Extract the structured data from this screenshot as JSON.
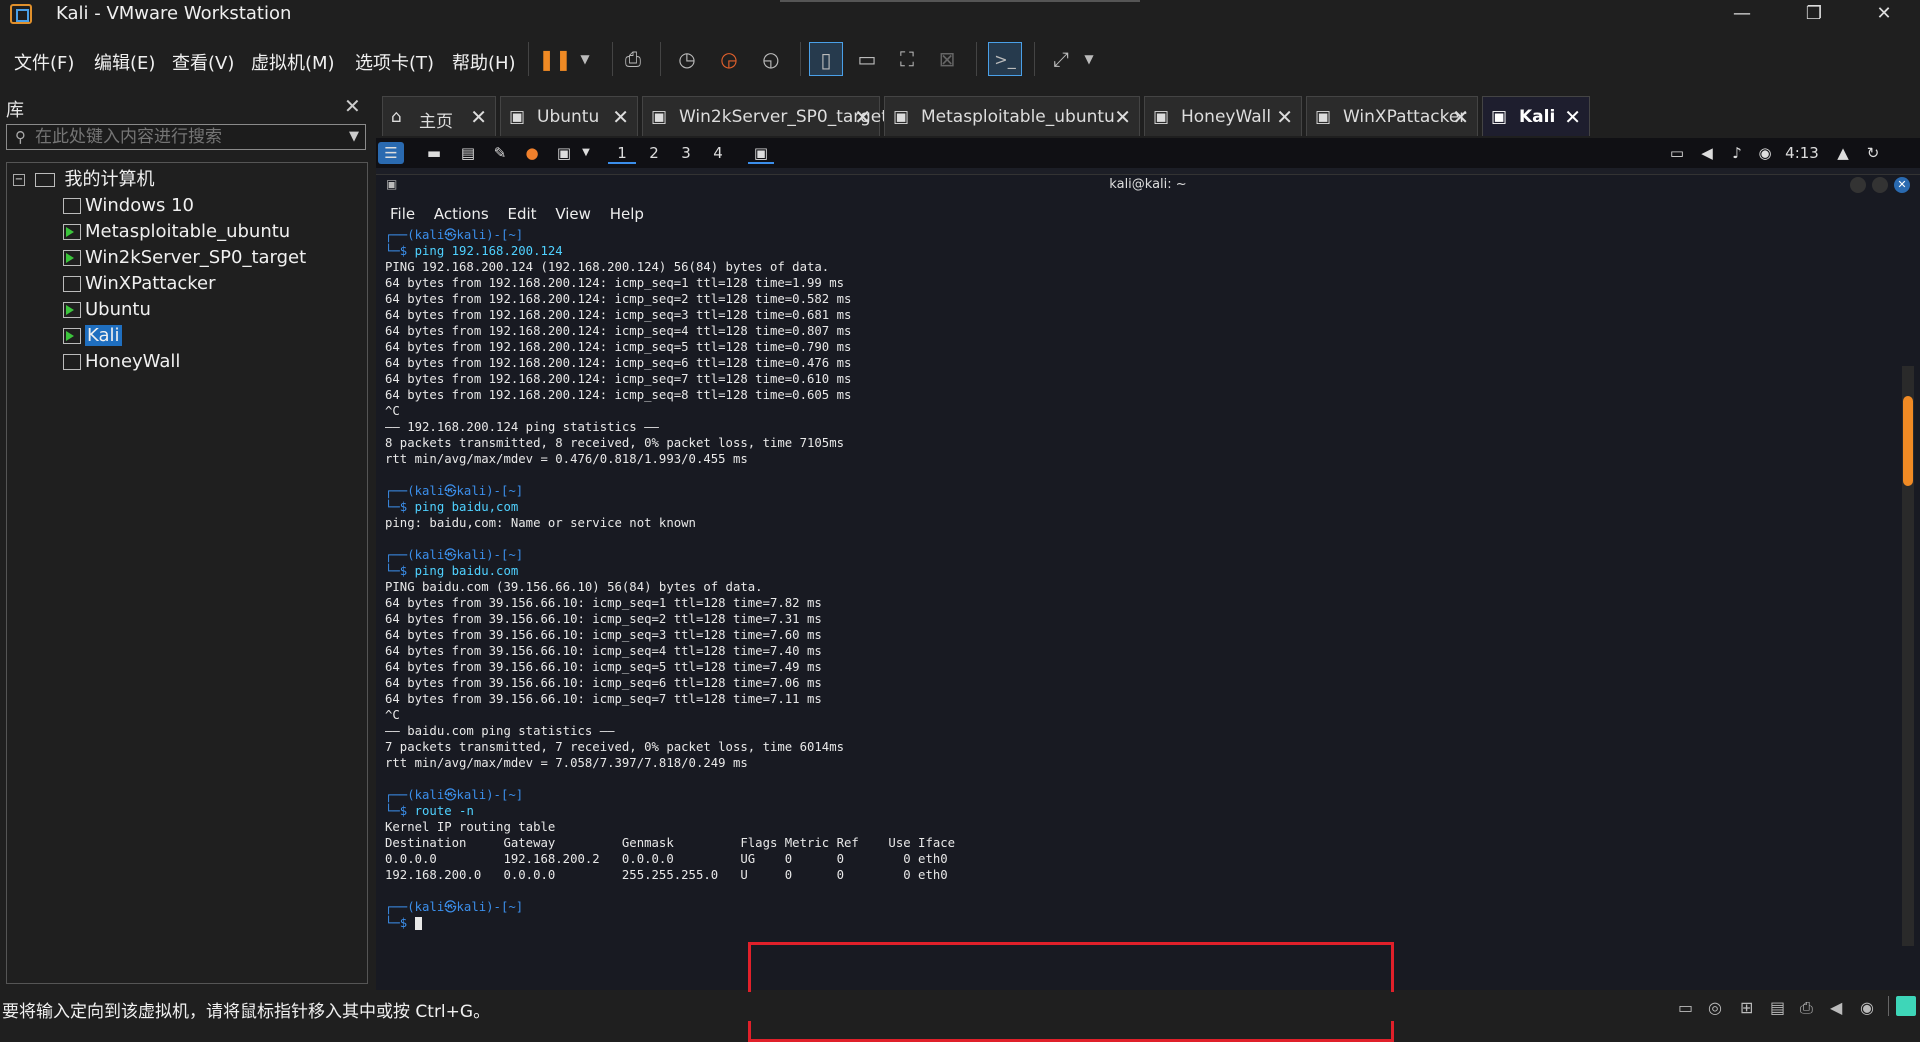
{
  "window": {
    "title": "Kali - VMware Workstation",
    "min": "—",
    "max": "❐",
    "close": "✕"
  },
  "menu": [
    "文件(F)",
    "编辑(E)",
    "查看(V)",
    "虚拟机(M)",
    "选项卡(T)",
    "帮助(H)"
  ],
  "library": {
    "title": "库",
    "close": "✕",
    "search_placeholder": "在此处键入内容进行搜索",
    "root": "我的计算机",
    "items": [
      "Windows 10",
      "Metasploitable_ubuntu",
      "Win2kServer_SP0_target",
      "WinXPattacker",
      "Ubuntu",
      "Kali",
      "HoneyWall"
    ],
    "selected": "Kali"
  },
  "tabs": [
    {
      "label": "主页",
      "icon": "⌂"
    },
    {
      "label": "Ubuntu"
    },
    {
      "label": "Win2kServer_SP0_target"
    },
    {
      "label": "Metasploitable_ubuntu"
    },
    {
      "label": "HoneyWall"
    },
    {
      "label": "WinXPattacker"
    },
    {
      "label": "Kali",
      "active": true
    }
  ],
  "kali_panel": {
    "workspaces": [
      "1",
      "2",
      "3",
      "4"
    ],
    "time": "4:13"
  },
  "terminal": {
    "title": "kali@kali: ~",
    "menu": [
      "File",
      "Actions",
      "Edit",
      "View",
      "Help"
    ],
    "lines": [
      {
        "t": "p"
      },
      {
        "t": "c",
        "v": "ping 192.168.200.124"
      },
      {
        "t": "o",
        "v": "PING 192.168.200.124 (192.168.200.124) 56(84) bytes of data."
      },
      {
        "t": "o",
        "v": "64 bytes from 192.168.200.124: icmp_seq=1 ttl=128 time=1.99 ms"
      },
      {
        "t": "o",
        "v": "64 bytes from 192.168.200.124: icmp_seq=2 ttl=128 time=0.582 ms"
      },
      {
        "t": "o",
        "v": "64 bytes from 192.168.200.124: icmp_seq=3 ttl=128 time=0.681 ms"
      },
      {
        "t": "o",
        "v": "64 bytes from 192.168.200.124: icmp_seq=4 ttl=128 time=0.807 ms"
      },
      {
        "t": "o",
        "v": "64 bytes from 192.168.200.124: icmp_seq=5 ttl=128 time=0.790 ms"
      },
      {
        "t": "o",
        "v": "64 bytes from 192.168.200.124: icmp_seq=6 ttl=128 time=0.476 ms"
      },
      {
        "t": "o",
        "v": "64 bytes from 192.168.200.124: icmp_seq=7 ttl=128 time=0.610 ms"
      },
      {
        "t": "o",
        "v": "64 bytes from 192.168.200.124: icmp_seq=8 ttl=128 time=0.605 ms"
      },
      {
        "t": "o",
        "v": "^C"
      },
      {
        "t": "o",
        "v": "—— 192.168.200.124 ping statistics ——"
      },
      {
        "t": "o",
        "v": "8 packets transmitted, 8 received, 0% packet loss, time 7105ms"
      },
      {
        "t": "o",
        "v": "rtt min/avg/max/mdev = 0.476/0.818/1.993/0.455 ms"
      },
      {
        "t": "o",
        "v": ""
      },
      {
        "t": "p"
      },
      {
        "t": "c",
        "v": "ping baidu,com"
      },
      {
        "t": "o",
        "v": "ping: baidu,com: Name or service not known"
      },
      {
        "t": "o",
        "v": ""
      },
      {
        "t": "p"
      },
      {
        "t": "c",
        "v": "ping baidu.com"
      },
      {
        "t": "o",
        "v": "PING baidu.com (39.156.66.10) 56(84) bytes of data."
      },
      {
        "t": "o",
        "v": "64 bytes from 39.156.66.10: icmp_seq=1 ttl=128 time=7.82 ms"
      },
      {
        "t": "o",
        "v": "64 bytes from 39.156.66.10: icmp_seq=2 ttl=128 time=7.31 ms"
      },
      {
        "t": "o",
        "v": "64 bytes from 39.156.66.10: icmp_seq=3 ttl=128 time=7.60 ms"
      },
      {
        "t": "o",
        "v": "64 bytes from 39.156.66.10: icmp_seq=4 ttl=128 time=7.40 ms"
      },
      {
        "t": "o",
        "v": "64 bytes from 39.156.66.10: icmp_seq=5 ttl=128 time=7.49 ms"
      },
      {
        "t": "o",
        "v": "64 bytes from 39.156.66.10: icmp_seq=6 ttl=128 time=7.06 ms"
      },
      {
        "t": "o",
        "v": "64 bytes from 39.156.66.10: icmp_seq=7 ttl=128 time=7.11 ms"
      },
      {
        "t": "o",
        "v": "^C"
      },
      {
        "t": "o",
        "v": "—— baidu.com ping statistics ——"
      },
      {
        "t": "o",
        "v": "7 packets transmitted, 7 received, 0% packet loss, time 6014ms"
      },
      {
        "t": "o",
        "v": "rtt min/avg/max/mdev = 7.058/7.397/7.818/0.249 ms"
      },
      {
        "t": "o",
        "v": ""
      },
      {
        "t": "p"
      },
      {
        "t": "c",
        "v": "route -n"
      },
      {
        "t": "o",
        "v": "Kernel IP routing table"
      },
      {
        "t": "o",
        "v": "Destination     Gateway         Genmask         Flags Metric Ref    Use Iface"
      },
      {
        "t": "o",
        "v": "0.0.0.0         192.168.200.2   0.0.0.0         UG    0      0        0 eth0"
      },
      {
        "t": "o",
        "v": "192.168.200.0   0.0.0.0         255.255.255.0   U     0      0        0 eth0"
      },
      {
        "t": "o",
        "v": ""
      },
      {
        "t": "p"
      },
      {
        "t": "c",
        "v": ""
      }
    ],
    "prompt_top": "┌──(kali㉿kali)-[~]",
    "prompt_bottom": "└─$ "
  },
  "status": {
    "message": "要将输入定向到该虚拟机，请将鼠标指针移入其中或按 Ctrl+G。"
  },
  "colors": {
    "accent": "#1f6fc0",
    "highlight_box": "#e0202a",
    "running": "#3cc43c",
    "pause": "#f08a24"
  }
}
